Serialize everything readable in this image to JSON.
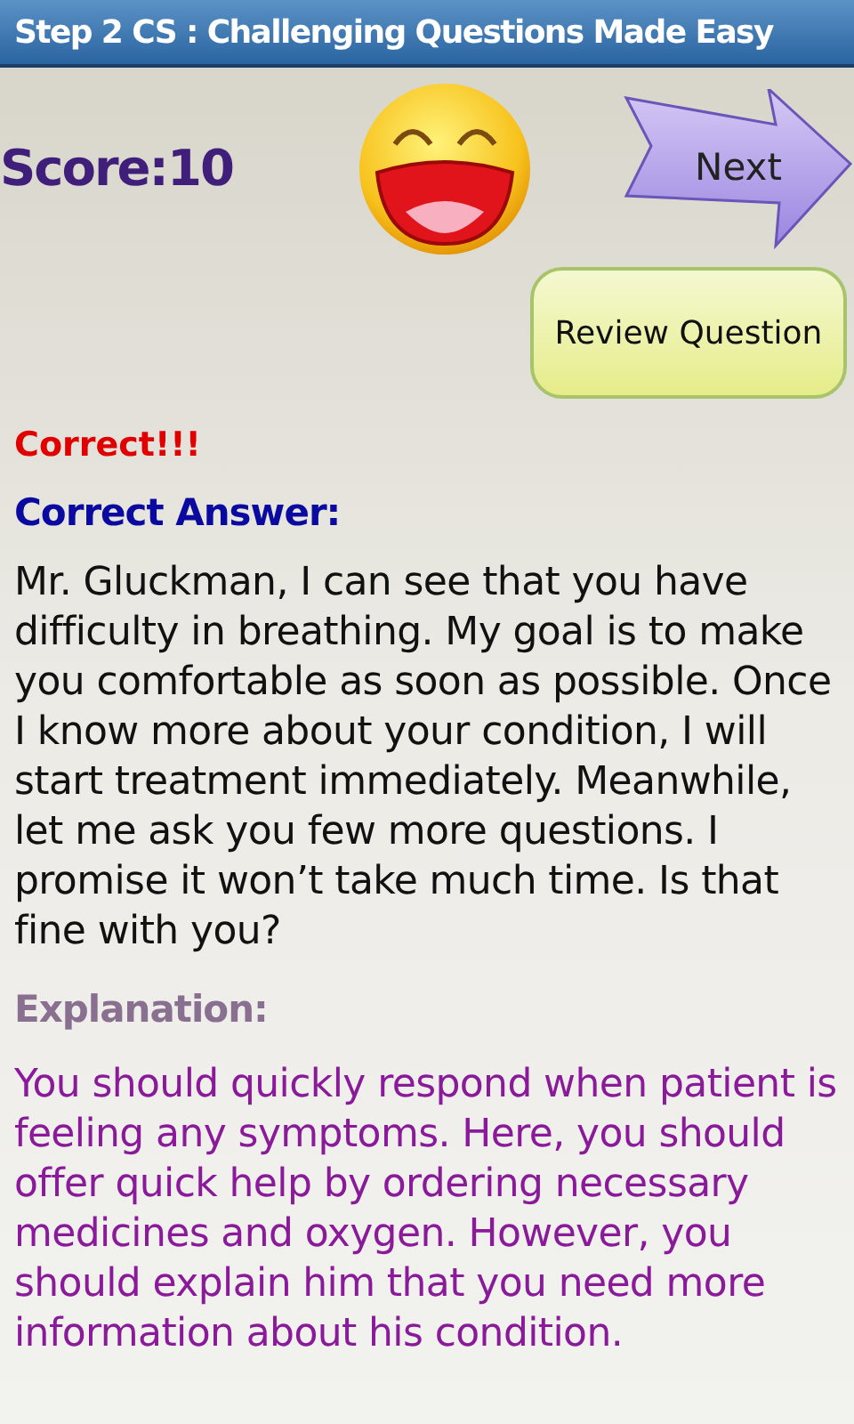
{
  "window": {
    "title": "Step 2 CS : Challenging Questions Made Easy"
  },
  "score": "Score:10",
  "next_button": "Next",
  "review_button": "Review Question",
  "result": {
    "text": "Correct!!!",
    "correct": true
  },
  "answer": {
    "heading": "Correct Answer:",
    "text": "Mr. Gluckman, I can see that you have difficulty in breathing. My goal is to make you comfortable as soon as possible. Once I know more about your condition, I will start treatment immediately. Meanwhile, let me ask you few more questions. I promise it won’t take much time. Is that fine with you?"
  },
  "explanation": {
    "heading": "Explanation:",
    "text": "You should quickly respond when patient is feeling any symptoms. Here, you should offer quick help by ordering necessary medicines and oxygen. However, you should explain him that you need more information about his condition."
  }
}
